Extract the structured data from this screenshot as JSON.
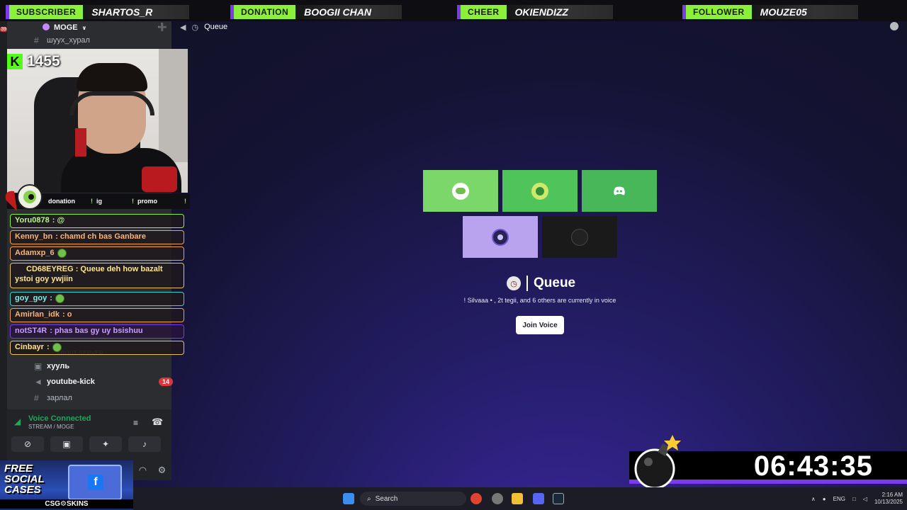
{
  "alerts": [
    {
      "type": "SUBSCRIBER",
      "name": "SHARTOS_R"
    },
    {
      "type": "DONATION",
      "name": "BOOGII CHAN"
    },
    {
      "type": "CHEER",
      "name": "OKIENDIZZ"
    },
    {
      "type": "FOLLOWER",
      "name": "MOUZE05"
    }
  ],
  "rail": {
    "badge": "39"
  },
  "server": {
    "name": "MOGE",
    "top_channel": "шуух_хурал"
  },
  "channels": [
    {
      "name": "хууль",
      "badge": ""
    },
    {
      "name": "youtube-kick",
      "badge": "14"
    },
    {
      "name": "зарлал",
      "badge": ""
    }
  ],
  "channel_category": "ABOUT SERVER",
  "voice": {
    "status": "Voice Connected",
    "channel": "STREAM / MOGE"
  },
  "kick": {
    "followers": "1455"
  },
  "commands": [
    "donation",
    "ig",
    "promo"
  ],
  "chat": [
    {
      "user": "Yoru0878",
      "text": ": @",
      "style": "green"
    },
    {
      "user": "Kenny_bn",
      "text": ": chamd ch bas Ganbare",
      "style": "orange"
    },
    {
      "user": "Adamxp_6",
      "text": "",
      "style": "orange"
    },
    {
      "user": "CD68EYREG",
      "text": ": Queue deh how bazalt ystoi goy ywjiin",
      "style": "gold"
    },
    {
      "user": "goy_goy",
      "text": ":",
      "style": "cyan"
    },
    {
      "user": "Amirlan_idk",
      "text": ": o",
      "style": "orange"
    },
    {
      "user": "notST4R",
      "text": ": phas bas gy uy bsishuu",
      "style": "purple"
    },
    {
      "user": "Cinbayr",
      "text": ":",
      "style": "gold"
    }
  ],
  "main": {
    "channel_title": "Queue",
    "queue_title": "Queue",
    "voice_info": "! Silvaaa • , 2t tegii, and 6 others are currently in voice",
    "join_label": "Join Voice"
  },
  "tiles": [
    {
      "color": "#7bd76a"
    },
    {
      "color": "#4fc45a"
    },
    {
      "color": "#47b75a"
    },
    {
      "color": "#b9a3ee"
    },
    {
      "color": "#1a1a1a"
    }
  ],
  "timer": {
    "value": "06:43:35"
  },
  "promo": {
    "line1": "FREE",
    "line2": "SOCIAL",
    "line3": "CASES",
    "brand": "CSG⚙SKINS"
  },
  "taskbar": {
    "search_label": "Search",
    "lang": "ENG",
    "time": "2:16 AM",
    "date": "10/13/2025"
  }
}
